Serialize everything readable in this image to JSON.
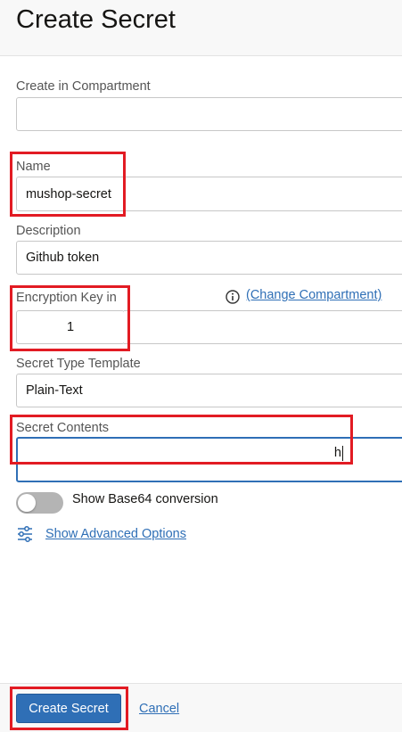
{
  "page": {
    "title": "Create Secret"
  },
  "form": {
    "compartment": {
      "label": "Create in Compartment",
      "value": ""
    },
    "name": {
      "label": "Name",
      "value": "mushop-secret"
    },
    "description": {
      "label": "Description",
      "value": "Github token"
    },
    "encryption_key": {
      "label": "Encryption Key in",
      "value": "1",
      "change_link": "(Change Compartment)",
      "info_icon": "info-circle-icon"
    },
    "secret_type": {
      "label": "Secret Type Template",
      "value": "Plain-Text"
    },
    "secret_contents": {
      "label": "Secret Contents",
      "value": "h"
    },
    "base64_toggle": {
      "label": "Show Base64 conversion",
      "checked": false
    },
    "advanced_options": {
      "label": "Show Advanced Options",
      "icon": "sliders-icon"
    }
  },
  "footer": {
    "create_label": "Create Secret",
    "cancel_label": "Cancel"
  },
  "colors": {
    "accent": "#2f6fb6",
    "highlight": "#e21b23"
  }
}
